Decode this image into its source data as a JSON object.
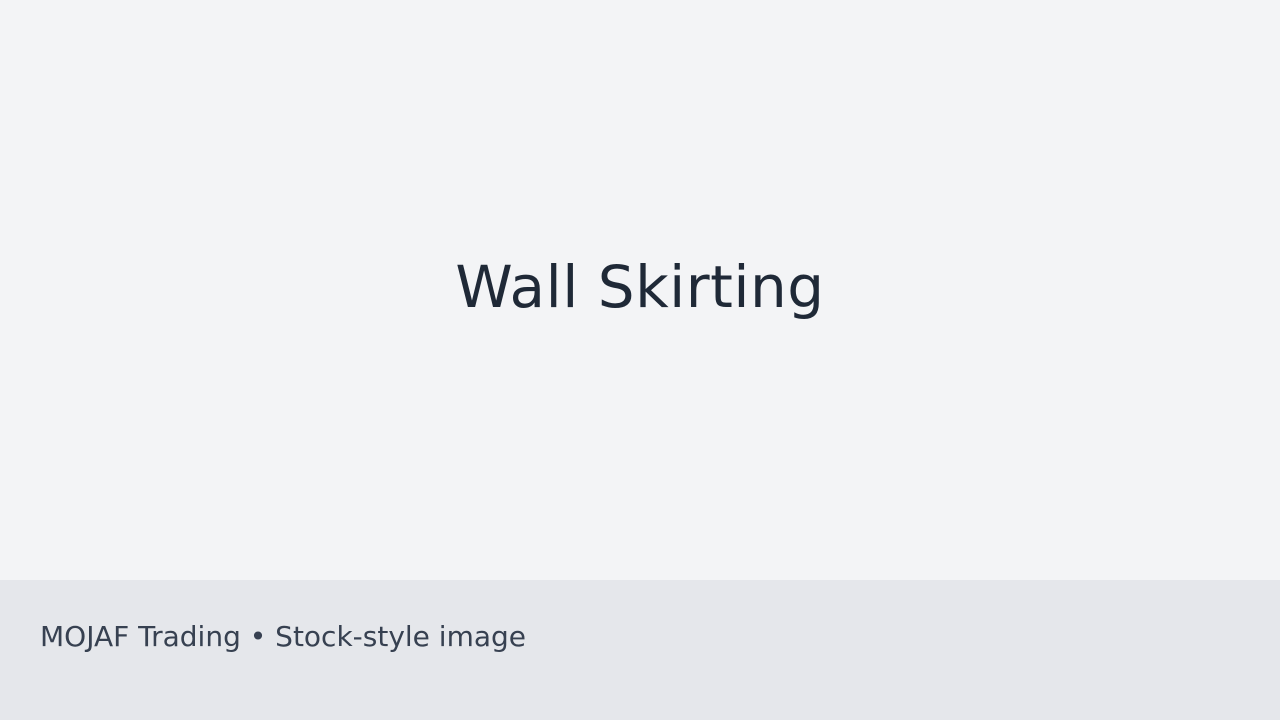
{
  "hero": {
    "title": "Wall Skirting"
  },
  "footer": {
    "caption": "MOJAF Trading • Stock-style image"
  },
  "colors": {
    "hero_background": "#f3f4f6",
    "footer_background": "#e5e7eb",
    "title_text": "#1f2937",
    "caption_text": "#374151"
  }
}
